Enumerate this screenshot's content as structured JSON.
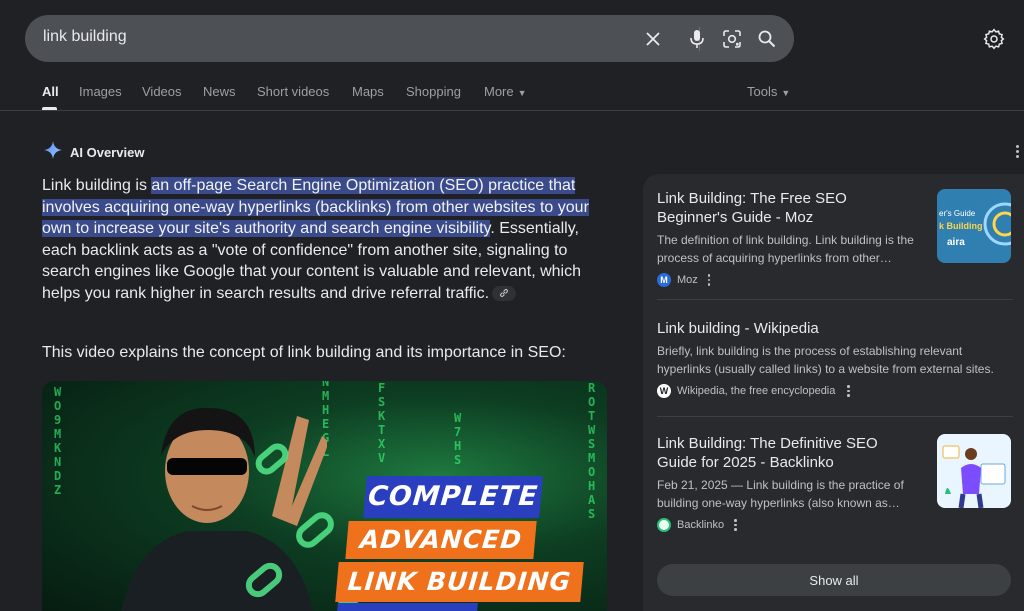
{
  "search": {
    "query": "link building"
  },
  "tabs": [
    {
      "label": "All"
    },
    {
      "label": "Images"
    },
    {
      "label": "Videos"
    },
    {
      "label": "News"
    },
    {
      "label": "Short videos"
    },
    {
      "label": "Maps"
    },
    {
      "label": "Shopping"
    },
    {
      "label": "More"
    }
  ],
  "tools_label": "Tools",
  "ai_overview": {
    "label": "AI Overview",
    "text_intro": "Link building is ",
    "text_highlight": "an off-page Search Engine Optimization (SEO) practice that involves acquiring one-way hyperlinks (backlinks) from other websites to your own to increase your site's authority and search engine visibility",
    "text_rest": ". Essentially, each backlink acts as a \"vote of confidence\" from another site, signaling to search engines like Google that your content is valuable and relevant, which helps you rank higher in search results and drive referral traffic.",
    "video_intro": "This video explains the concept of link building and its importance in SEO:"
  },
  "video": {
    "banner1": "COMPLETE",
    "banner2": "ADVANCED",
    "banner3": "LINK BUILDING"
  },
  "sources": [
    {
      "title": "Link Building: The Free SEO Beginner's Guide - Moz",
      "snippet": "The definition of link building. Link building is the process of acquiring hyperlinks from other…",
      "source": "Moz",
      "thumb_text1": "er's Guide",
      "thumb_text2": "k Building",
      "thumb_text3": "aira"
    },
    {
      "title": "Link building - Wikipedia",
      "snippet": "Briefly, link building is the process of establishing relevant hyperlinks (usually called links) to a website from external sites.",
      "source": "Wikipedia, the free encyclopedia"
    },
    {
      "title": "Link Building: The Definitive SEO Guide for 2025 - Backlinko",
      "snippet": "Feb 21, 2025 — Link building is the practice of building one-way hyperlinks (also known as…",
      "source": "Backlinko"
    }
  ],
  "show_all_label": "Show all",
  "colors": {
    "background": "#202124",
    "highlight": "#3a4a8a",
    "panel": "#282a2d",
    "banner_blue": "#2a3ec0",
    "banner_orange": "#f0711b"
  }
}
